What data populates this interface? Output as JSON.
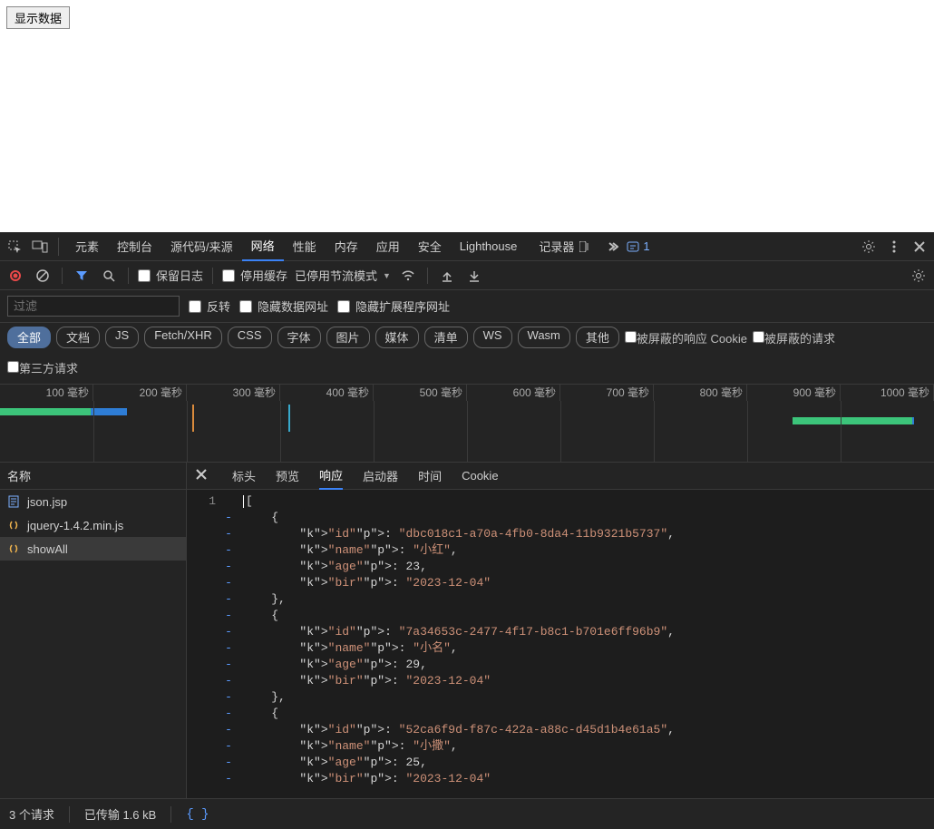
{
  "page": {
    "button_label": "显示数据"
  },
  "tabs": {
    "items": [
      "元素",
      "控制台",
      "源代码/来源",
      "网络",
      "性能",
      "内存",
      "应用",
      "安全",
      "Lighthouse"
    ],
    "recorder_label": "记录器",
    "active": "网络",
    "issues_count": "1"
  },
  "toolbar": {
    "preserve_log": "保留日志",
    "disable_cache": "停用缓存",
    "throttling_label": "已停用节流模式"
  },
  "filterbar": {
    "placeholder": "过滤",
    "invert": "反转",
    "hide_data_urls": "隐藏数据网址",
    "hide_ext_urls": "隐藏扩展程序网址",
    "types": [
      "全部",
      "文档",
      "JS",
      "Fetch/XHR",
      "CSS",
      "字体",
      "图片",
      "媒体",
      "清单",
      "WS",
      "Wasm",
      "其他"
    ],
    "types_active": "全部",
    "blocked_cookies": "被屏蔽的响应 Cookie",
    "blocked_requests": "被屏蔽的请求",
    "third_party": "第三方请求"
  },
  "timeline": {
    "ticks": [
      "100 毫秒",
      "200 毫秒",
      "300 毫秒",
      "400 毫秒",
      "500 毫秒",
      "600 毫秒",
      "700 毫秒",
      "800 毫秒",
      "900 毫秒",
      "1000 毫秒"
    ]
  },
  "requests": {
    "header": "名称",
    "items": [
      {
        "icon": "doc",
        "name": "json.jsp"
      },
      {
        "icon": "js",
        "name": "jquery-1.4.2.min.js"
      },
      {
        "icon": "xhr",
        "name": "showAll"
      }
    ],
    "selected": 2
  },
  "detail": {
    "tabs": [
      "标头",
      "预览",
      "响应",
      "启动器",
      "时间",
      "Cookie"
    ],
    "active": "响应",
    "gutter_first": "1",
    "gutter_fold": "-",
    "code_lines": [
      "|[",
      "    {",
      "        \"id\": \"dbc018c1-a70a-4fb0-8da4-11b9321b5737\",",
      "        \"name\": \"小红\",",
      "        \"age\": 23,",
      "        \"bir\": \"2023-12-04\"",
      "    },",
      "    {",
      "        \"id\": \"7a34653c-2477-4f17-b8c1-b701e6ff96b9\",",
      "        \"name\": \"小名\",",
      "        \"age\": 29,",
      "        \"bir\": \"2023-12-04\"",
      "    },",
      "    {",
      "        \"id\": \"52ca6f9d-f87c-422a-a88c-d45d1b4e61a5\",",
      "        \"name\": \"小撒\",",
      "        \"age\": 25,",
      "        \"bir\": \"2023-12-04\""
    ]
  },
  "status": {
    "requests": "3 个请求",
    "transferred": "已传输 1.6 kB"
  }
}
